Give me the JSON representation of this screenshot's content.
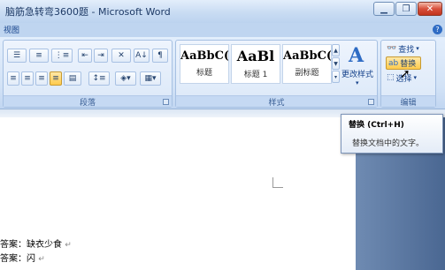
{
  "window": {
    "title": "脑筋急转弯3600题 - Microsoft Word",
    "minimize_icon": "minimize-icon",
    "maximize_icon": "restore-icon",
    "close_icon": "close-icon"
  },
  "tabs": {
    "view": "视图",
    "help": "?"
  },
  "ribbon": {
    "paragraph_group_label": "段落",
    "styles_group_label": "样式",
    "editing_group_label": "编辑",
    "styles": [
      {
        "sample": "AaBbC(",
        "name": "标题"
      },
      {
        "sample": "AaBl",
        "name": "标题 1"
      },
      {
        "sample": "AaBbC(",
        "name": "副标题"
      }
    ],
    "change_styles_label": "更改样式",
    "find_label": "查找",
    "replace_label": "替换",
    "select_label": "选择"
  },
  "tooltip": {
    "title": "替换 (Ctrl+H)",
    "description": "替换文档中的文字。"
  },
  "document": {
    "lines": [
      {
        "text": "答案：缺衣少食",
        "mark": "↵"
      },
      {
        "text": "答案：闪",
        "mark": "↵"
      }
    ]
  },
  "colors": {
    "accent": "#2f6cc4",
    "ribbon_bg": "#d2e2f6",
    "active_button": "#ffcb4c"
  }
}
